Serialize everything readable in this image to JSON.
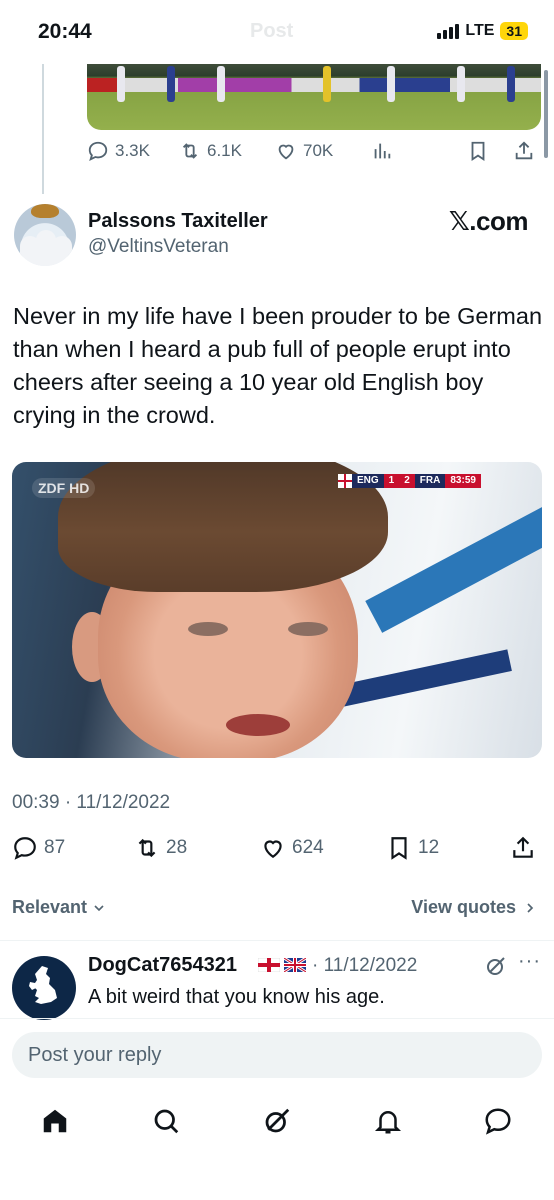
{
  "status_bar": {
    "time": "20:44",
    "ghost_title": "Post",
    "network": "LTE",
    "battery": "31"
  },
  "previous_tweet": {
    "actions": {
      "replies": "3.3K",
      "reposts": "6.1K",
      "likes": "70K"
    }
  },
  "tweet": {
    "display_name": "Palssons Taxiteller",
    "handle": "@VeltinsVeteran",
    "brand": "𝕏.com",
    "text": "Never in my life have I been prouder to be German than when I heard a pub full of people erupt into cheers after seeing a 10 year old English boy crying in the crowd.",
    "media": {
      "broadcaster_logo": "ZDF HD",
      "scoreboard": {
        "home": "ENG",
        "home_score": "1",
        "away_score": "2",
        "away": "FRA",
        "clock": "83:59"
      }
    },
    "timestamp": "00:39 · 11/12/2022",
    "actions": {
      "replies": "87",
      "reposts": "28",
      "likes": "624",
      "bookmarks": "12"
    }
  },
  "replies_header": {
    "sort_label": "Relevant",
    "view_quotes_label": "View quotes"
  },
  "reply": {
    "display_name": "DogCat7654321",
    "date": "· 11/12/2022",
    "text": "A bit weird that you know his age."
  },
  "composer": {
    "placeholder": "Post your reply"
  },
  "colors": {
    "text": "#0f1419",
    "secondary": "#536471",
    "battery": "#ffd60a"
  },
  "icons": [
    "reply-icon",
    "repost-icon",
    "like-icon",
    "views-icon",
    "bookmark-icon",
    "share-icon",
    "chevron-down-icon",
    "chevron-right-icon",
    "grok-icon",
    "more-icon",
    "home-icon",
    "search-icon",
    "grok-tab-icon",
    "notifications-icon",
    "messages-icon"
  ]
}
